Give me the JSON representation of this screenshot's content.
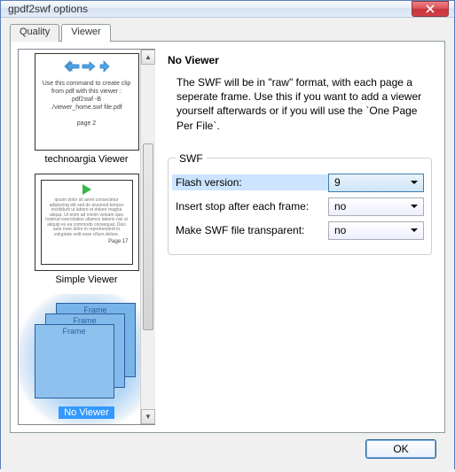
{
  "window": {
    "title": "gpdf2swf options"
  },
  "tabs": {
    "quality": "Quality",
    "viewer": "Viewer"
  },
  "viewers": {
    "item0": {
      "label": "technoargia Viewer",
      "thumb_line1": "Use this command to create clip from pdf with this viewer :",
      "thumb_line2": "pdf2swf -B",
      "thumb_line3": "./viewer_home.swf file.pdf",
      "thumb_page": "page 2"
    },
    "item1": {
      "label": "Simple Viewer",
      "thumb_filler": "ipsum dolor sit amet consectetur adipiscing elit sed do eiusmod tempor incididunt ut labore et dolore magna aliqua. Ut enim ad minim veniam quis nostrud exercitation ullamco laboris nisi ut aliquip ex ea commodo consequat. Duis aute irure dolor in reprehenderit in voluptate velit esse cillum dolore.",
      "thumb_page": "Page 17"
    },
    "item2": {
      "label": "No Viewer",
      "frame_label": "Frame"
    }
  },
  "right": {
    "title": "No Viewer",
    "description": "The SWF will be in \"raw\" format, with each page a seperate frame. Use this if you want to add a viewer yourself afterwards or if you will use the `One Page Per File`."
  },
  "swf_group": {
    "legend": "SWF",
    "flash_version_label": "Flash version:",
    "flash_version_value": "9",
    "insert_stop_label": "Insert stop after each frame:",
    "insert_stop_value": "no",
    "transparent_label": "Make SWF file transparent:",
    "transparent_value": "no"
  },
  "buttons": {
    "ok": "OK"
  }
}
